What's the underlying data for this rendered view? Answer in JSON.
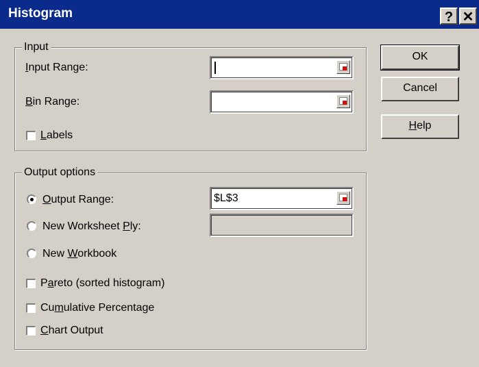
{
  "window": {
    "title": "Histogram",
    "help_glyph": "?",
    "close_glyph": "✕"
  },
  "input_group": {
    "legend": "Input",
    "input_range": {
      "label_accel": "I",
      "label_rest": "nput Range:",
      "value": ""
    },
    "bin_range": {
      "label_accel": "B",
      "label_rest": "in Range:",
      "value": ""
    },
    "labels": {
      "label_accel": "L",
      "label_rest": "abels",
      "checked": false
    }
  },
  "output_group": {
    "legend": "Output options",
    "output_range": {
      "label_pre": "",
      "label_accel": "O",
      "label_rest": "utput Range:",
      "value": "$L$3",
      "selected": true
    },
    "new_worksheet": {
      "label_pre": "New Worksheet ",
      "label_accel": "P",
      "label_rest": "ly:",
      "value": "",
      "selected": false
    },
    "new_workbook": {
      "label_pre": "New ",
      "label_accel": "W",
      "label_rest": "orkbook",
      "selected": false
    },
    "pareto": {
      "label_pre": "P",
      "label_accel": "a",
      "label_rest": "reto (sorted histogram)",
      "checked": false
    },
    "cumulative": {
      "label_pre": "Cu",
      "label_accel": "m",
      "label_rest": "ulative Percentage",
      "checked": false
    },
    "chart_output": {
      "label_pre": "",
      "label_accel": "C",
      "label_rest": "hart Output",
      "checked": false
    }
  },
  "buttons": {
    "ok": "OK",
    "cancel": "Cancel",
    "help_accel": "H",
    "help_rest": "elp"
  },
  "colors": {
    "titlebar": "#0a2a8c",
    "face": "#d4d0c8",
    "ref_icon_red": "#d01010"
  },
  "icons": {
    "range_ref": "collapse-dialog-icon"
  }
}
